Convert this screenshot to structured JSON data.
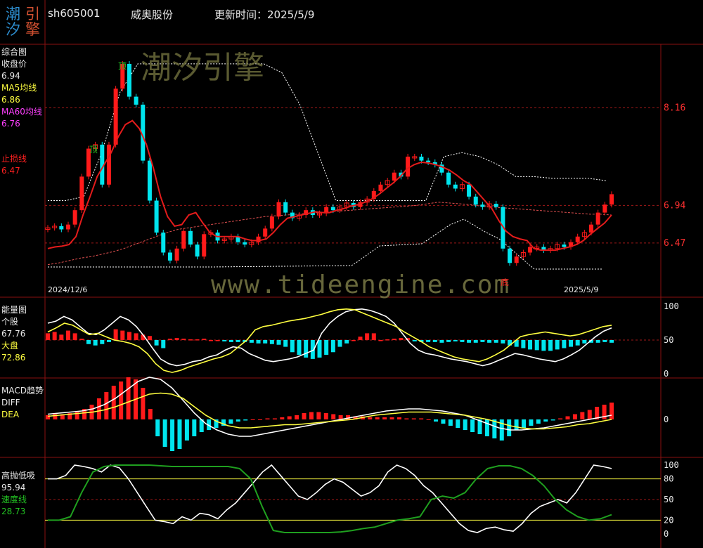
{
  "header": {
    "logo": [
      "潮",
      "引",
      "汐",
      "擎"
    ],
    "code": "sh605001",
    "name": "威奥股份",
    "update_label": "更新时间：2025/5/9"
  },
  "watermark": {
    "brand": "潮汐引擎",
    "url": "www.tideengine.com"
  },
  "panels": {
    "main": {
      "title": "综合图",
      "close_label": "收盘价",
      "close_value": "6.94",
      "ma5_label": "MA5均线",
      "ma5_value": "6.86",
      "ma60_label": "MA60均线",
      "ma60_value": "6.76",
      "stop_label": "止损线",
      "stop_value": "6.47",
      "date_start": "2024/12/6",
      "date_end": "2025/5/9",
      "top_marker": "顶",
      "bottom_marker": "底"
    },
    "energy": {
      "title": "能量图",
      "stock_label": "个股",
      "stock_value": "67.76",
      "market_label": "大盘",
      "market_value": "72.86"
    },
    "macd": {
      "title": "MACD趋势",
      "diff_label": "DIFF",
      "dea_label": "DEA"
    },
    "hl": {
      "title": "高抛低吸",
      "value": "95.94",
      "speed_label": "速度线",
      "speed_value": "28.73"
    }
  },
  "colors": {
    "up": "#ff1a1a",
    "down": "#00e5ee",
    "ma": "#e41b1b",
    "yellow": "#ffff40",
    "white": "#ffffff",
    "green": "#1fa01f",
    "grid": "#8a1010"
  },
  "chart_data": [
    {
      "type": "candlestick",
      "title": "综合图",
      "x": [
        "2024/12/6",
        "2025/5/9"
      ],
      "y_ticks": [
        6.47,
        6.94,
        8.16
      ],
      "ylim": [
        5.95,
        8.85
      ],
      "series_close": [
        6.66,
        6.68,
        6.64,
        6.7,
        6.88,
        7.3,
        7.65,
        7.7,
        7.2,
        7.7,
        8.4,
        8.71,
        8.3,
        8.2,
        7.5,
        7.0,
        6.6,
        6.35,
        6.25,
        6.4,
        6.62,
        6.45,
        6.3,
        6.58,
        6.6,
        6.5,
        6.52,
        6.55,
        6.48,
        6.45,
        6.48,
        6.55,
        6.65,
        6.8,
        6.98,
        6.85,
        6.78,
        6.82,
        6.88,
        6.82,
        6.84,
        6.92,
        6.88,
        6.92,
        6.97,
        6.92,
        6.98,
        7.02,
        7.12,
        7.2,
        7.25,
        7.35,
        7.3,
        7.55,
        7.55,
        7.5,
        7.48,
        7.45,
        7.35,
        7.2,
        7.15,
        7.2,
        7.05,
        6.95,
        6.92,
        6.96,
        6.92,
        6.4,
        6.22,
        6.3,
        6.35,
        6.42,
        6.42,
        6.38,
        6.4,
        6.45,
        6.42,
        6.48,
        6.55,
        6.6,
        6.7,
        6.85,
        6.95,
        7.08
      ],
      "ma5": [
        6.4,
        6.42,
        6.43,
        6.45,
        6.55,
        6.82,
        7.05,
        7.3,
        7.45,
        7.6,
        7.8,
        7.95,
        8.0,
        7.9,
        7.7,
        7.4,
        7.05,
        6.8,
        6.68,
        6.7,
        6.82,
        6.85,
        6.72,
        6.6,
        6.55,
        6.55,
        6.55,
        6.55,
        6.52,
        6.5,
        6.5,
        6.52,
        6.6,
        6.7,
        6.78,
        6.8,
        6.82,
        6.84,
        6.86,
        6.85,
        6.85,
        6.88,
        6.9,
        6.93,
        6.95,
        6.98,
        7.02,
        7.08,
        7.15,
        7.22,
        7.3,
        7.4,
        7.45,
        7.48,
        7.47,
        7.45,
        7.42,
        7.38,
        7.32,
        7.25,
        7.2,
        7.1,
        7.0,
        6.9,
        6.75,
        6.62,
        6.55,
        6.52,
        6.5,
        6.4,
        6.38,
        6.38,
        6.38,
        6.4,
        6.42,
        6.45,
        6.5,
        6.58,
        6.65,
        6.72,
        6.82
      ],
      "ma60": [
        6.2,
        6.22,
        6.25,
        6.28,
        6.3,
        6.33,
        6.36,
        6.4,
        6.45,
        6.5,
        6.55,
        6.6,
        6.64,
        6.66,
        6.68,
        6.7,
        6.72,
        6.74,
        6.76,
        6.78,
        6.8,
        6.81,
        6.82,
        6.83,
        6.84,
        6.85,
        6.86,
        6.87,
        6.88,
        6.89,
        6.9,
        6.91,
        6.92,
        6.93,
        6.94,
        6.96,
        6.98,
        6.97,
        6.96,
        6.95,
        6.93,
        6.92,
        6.91,
        6.9,
        6.89,
        6.88,
        6.87,
        6.86,
        6.85,
        6.84,
        6.83,
        6.83,
        6.82
      ],
      "upper_band": [
        7.0,
        7.0,
        7.05,
        7.6,
        8.35,
        8.71,
        8.71,
        8.71,
        8.71,
        8.71,
        8.71,
        8.71,
        8.71,
        8.6,
        8.2,
        7.6,
        7.0,
        7.0,
        7.0,
        7.0,
        7.0,
        7.0,
        7.55,
        7.6,
        7.55,
        7.45,
        7.3,
        7.3,
        7.28,
        7.28,
        7.28,
        7.25
      ]
    },
    {
      "type": "line+bar",
      "title": "能量图",
      "y_ticks": [
        0,
        50,
        100
      ],
      "ylim": [
        0,
        100
      ],
      "series": [
        {
          "name": "个股",
          "last": 67.76
        },
        {
          "name": "大盘",
          "last": 72.86
        }
      ],
      "bars": [
        10,
        12,
        8,
        14,
        10,
        2,
        -6,
        -8,
        -6,
        -3,
        16,
        14,
        12,
        10,
        8,
        6,
        -8,
        -12,
        2,
        3,
        2,
        1,
        1,
        2,
        0,
        0,
        -2,
        -3,
        -3,
        -3,
        -4,
        -5,
        -5,
        -6,
        -7,
        -10,
        -18,
        -22,
        -26,
        -28,
        -26,
        -22,
        -18,
        -10,
        -5,
        0,
        5,
        10,
        10,
        0,
        1,
        2,
        3,
        3,
        -2,
        -3,
        -3,
        -3,
        -4,
        -3,
        -2,
        -3,
        -4,
        -4,
        -3,
        -4,
        -4,
        -5,
        -8,
        -10,
        -12,
        -14,
        -15,
        -16,
        -16,
        -14,
        -12,
        -10,
        -8,
        -5,
        -4,
        -4,
        -3,
        -4
      ]
    },
    {
      "type": "macd",
      "title": "MACD趋势",
      "y_ticks": [
        0
      ],
      "series": [
        {
          "name": "DIFF"
        },
        {
          "name": "DEA"
        }
      ],
      "hist": [
        0.04,
        0.05,
        0.05,
        0.06,
        0.07,
        0.1,
        0.14,
        0.2,
        0.26,
        0.32,
        0.36,
        0.4,
        0.38,
        0.3,
        0.1,
        -0.16,
        -0.26,
        -0.3,
        -0.28,
        -0.2,
        -0.16,
        -0.12,
        -0.1,
        -0.08,
        -0.06,
        -0.04,
        -0.02,
        -0.01,
        0.0,
        0.0,
        0.01,
        0.01,
        0.02,
        0.03,
        0.04,
        0.06,
        0.07,
        0.07,
        0.06,
        0.05,
        0.04,
        0.04,
        0.03,
        0.03,
        0.02,
        0.02,
        0.02,
        0.02,
        0.02,
        0.01,
        0.01,
        0.01,
        0.0,
        -0.02,
        -0.04,
        -0.06,
        -0.08,
        -0.1,
        -0.12,
        -0.14,
        -0.16,
        -0.18,
        -0.2,
        -0.16,
        -0.1,
        -0.08,
        -0.06,
        -0.04,
        -0.02,
        -0.01,
        0.01,
        0.03,
        0.05,
        0.07,
        0.09,
        0.12,
        0.14,
        0.16
      ]
    },
    {
      "type": "line",
      "title": "高抛低吸",
      "y_ticks": [
        0,
        20,
        50,
        80,
        100
      ],
      "ylim": [
        0,
        100
      ],
      "series": [
        {
          "name": "高抛低吸",
          "last": 95.94
        },
        {
          "name": "速度线",
          "last": 28.73
        }
      ]
    }
  ]
}
